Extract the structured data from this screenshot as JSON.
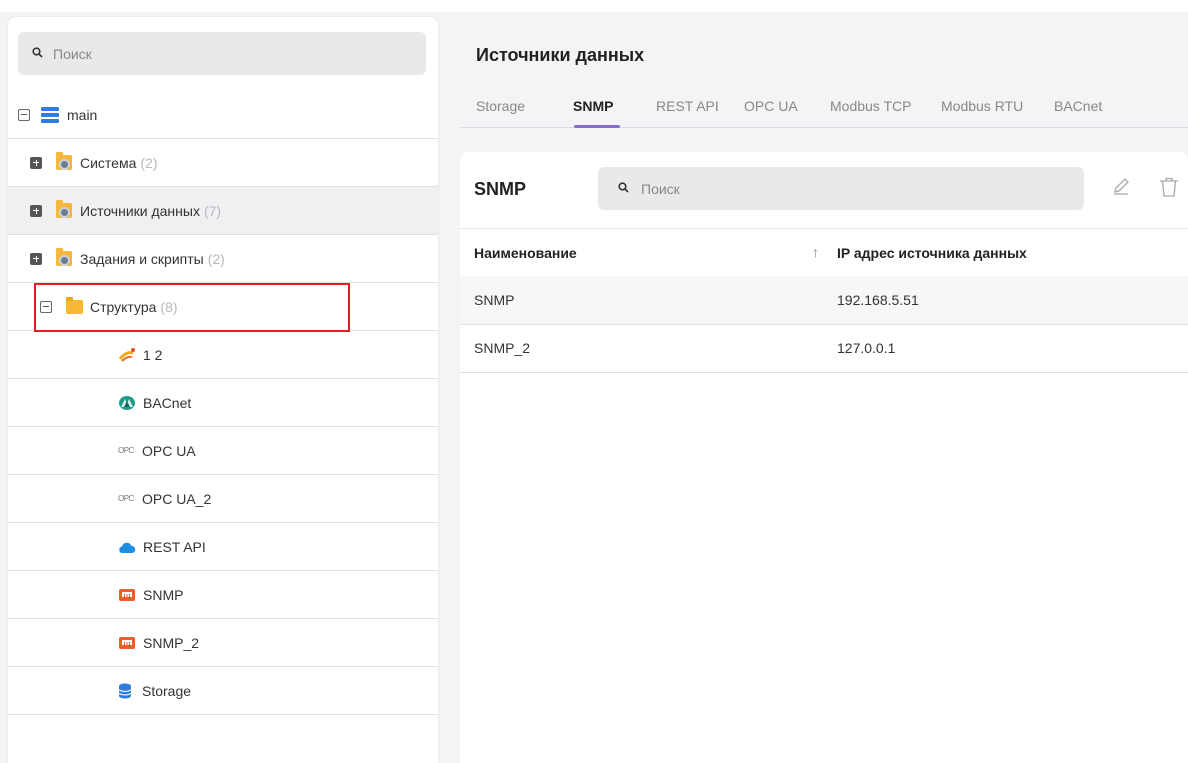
{
  "tree": {
    "search_placeholder": "Поиск",
    "root": {
      "label": "main"
    },
    "groups": [
      {
        "label": "Система",
        "count": "(2)"
      },
      {
        "label": "Источники данных",
        "count": "(7)"
      },
      {
        "label": "Задания и скрипты",
        "count": "(2)"
      },
      {
        "label": "Структура",
        "count": "(8)"
      }
    ],
    "children": [
      {
        "label": "1 2",
        "icon": "device-icon"
      },
      {
        "label": "BACnet",
        "icon": "bacnet-icon"
      },
      {
        "label": "OPC UA",
        "icon": "opc-icon",
        "icon_text": "OPC"
      },
      {
        "label": "OPC UA_2",
        "icon": "opc-icon",
        "icon_text": "OPC"
      },
      {
        "label": "REST API",
        "icon": "cloud-icon"
      },
      {
        "label": "SNMP",
        "icon": "snmp-icon"
      },
      {
        "label": "SNMP_2",
        "icon": "snmp-icon"
      },
      {
        "label": "Storage",
        "icon": "database-icon"
      }
    ]
  },
  "main": {
    "title": "Источники данных",
    "tabs": [
      "Storage",
      "SNMP",
      "REST API",
      "OPC UA",
      "Modbus TCP",
      "Modbus RTU",
      "BACnet"
    ],
    "active_tab": "SNMP",
    "card": {
      "title": "SNMP",
      "search_placeholder": "Поиск",
      "columns": [
        "Наименование",
        "IP адрес источника данных"
      ],
      "sort_glyph": "↑",
      "rows": [
        {
          "name": "SNMP",
          "ip": "192.168.5.51"
        },
        {
          "name": "SNMP_2",
          "ip": "127.0.0.1"
        }
      ]
    }
  },
  "colors": {
    "accent": "#8a6cd8",
    "highlight_border": "#e02020",
    "folder": "#f6b73c",
    "database": "#2f7de0"
  }
}
